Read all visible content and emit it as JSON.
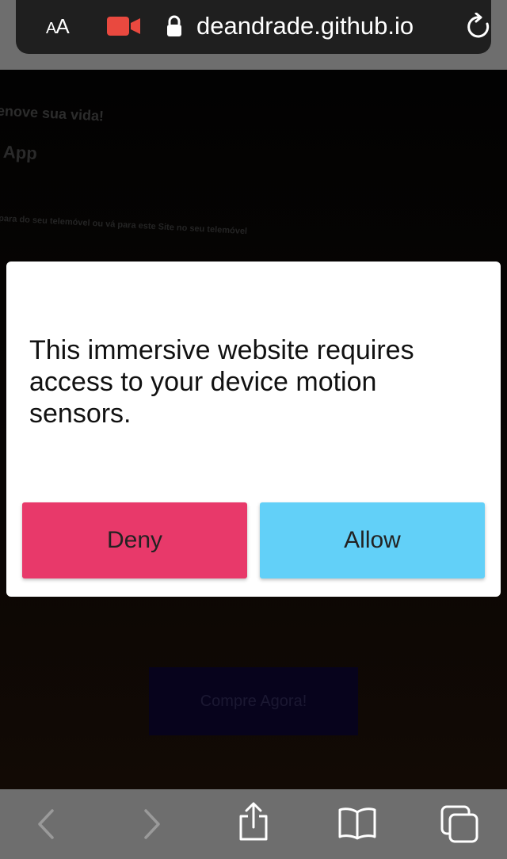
{
  "browser": {
    "text_size_label": "AA",
    "url_prefix": "",
    "url": "deandrade.github.io",
    "icons": [
      "text-size-icon",
      "camera-recording-icon",
      "lock-icon",
      "reload-icon"
    ],
    "recording_color": "#e9493f"
  },
  "background_page": {
    "line1": "enove sua vida!",
    "line2": "App",
    "line3": "para do seu telemóvel ou vá para este Site no seu telemóvel",
    "cta_label": "Compre Agora!"
  },
  "modal": {
    "message": "This immersive website requires access to your device motion sensors.",
    "deny_label": "Deny",
    "allow_label": "Allow",
    "deny_color": "#e8396a",
    "allow_color": "#62d0f8"
  },
  "toolbar": {
    "icons": [
      "back-icon",
      "forward-icon",
      "share-icon",
      "bookmarks-icon",
      "tabs-icon"
    ]
  }
}
